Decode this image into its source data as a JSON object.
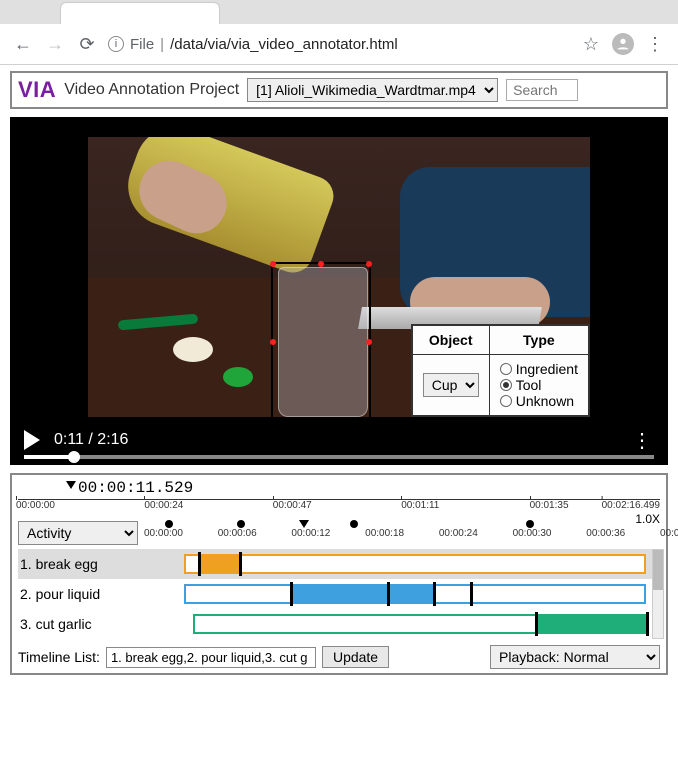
{
  "browser": {
    "url_prefix": "File",
    "url_path": "/data/via/via_video_annotator.html"
  },
  "app": {
    "logo": "VIA",
    "project_name": "Video Annotation Project",
    "file_selector": "[1] Alioli_Wikimedia_Wardtmar.mp4",
    "search_placeholder": "Search"
  },
  "video": {
    "current_time": "0:11",
    "duration": "2:16",
    "attribute_table": {
      "object_header": "Object",
      "type_header": "Type",
      "object_value": "Cup",
      "type_options": [
        "Ingredient",
        "Tool",
        "Unknown"
      ],
      "type_selected_index": 1
    }
  },
  "timeline": {
    "playhead_time": "00:00:11.529",
    "main_ticks": [
      "00:00:00",
      "00:00:24",
      "00:00:47",
      "00:01:11",
      "00:01:35",
      "00:02:16.499"
    ],
    "attribute_selector": "Activity",
    "speed_label": "1.0X",
    "sub_ticks": [
      "00:00:00",
      "00:00:06",
      "00:00:12",
      "00:00:18",
      "00:00:24",
      "00:00:30",
      "00:00:36",
      "00:0"
    ],
    "tracks": [
      {
        "label": "1. break egg",
        "color": "#f0a020",
        "outline": [
          0,
          100
        ],
        "fill": [
          3,
          12
        ],
        "bars": [
          3,
          12
        ],
        "selected": true
      },
      {
        "label": "2. pour liquid",
        "color": "#3fa0e0",
        "outline": [
          0,
          100
        ],
        "fill": [
          23,
          54
        ],
        "bars": [
          23,
          44,
          54,
          62
        ],
        "selected": false
      },
      {
        "label": "3. cut garlic",
        "color": "#1fae7a",
        "outline": [
          2,
          100
        ],
        "fill": [
          76,
          100
        ],
        "bars": [
          76,
          100
        ],
        "selected": false
      }
    ],
    "list_label": "Timeline List:",
    "list_value": "1. break egg,2. pour liquid,3. cut g",
    "update_btn": "Update",
    "playback_selector": "Playback: Normal"
  }
}
